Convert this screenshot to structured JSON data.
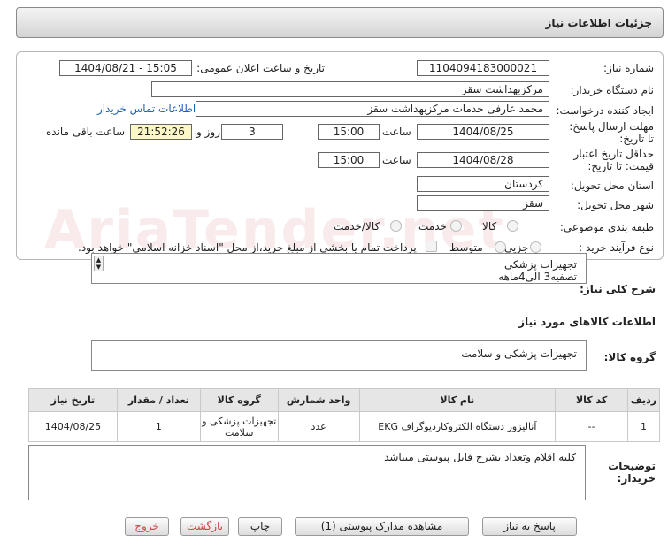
{
  "header": {
    "title": "جزئیات اطلاعات نیاز"
  },
  "watermark": "AriaTender.net",
  "form": {
    "need_number_label": "شماره نیاز:",
    "need_number": "1104094183000021",
    "announce_label": "تاریخ و ساعت اعلان عمومی:",
    "announce_value": "1404/08/21 - 15:05",
    "buyer_org_label": "نام دستگاه خریدار:",
    "buyer_org": "مرکزبهداشت سقز",
    "creator_label": "ایجاد کننده درخواست:",
    "creator": "محمد عارفی خدمات مرکزبهداشت سقز",
    "contact_link": "اطلاعات تماس خریدار",
    "reply_deadline_label": "مهلت ارسال پاسخ: تا تاریخ:",
    "reply_date": "1404/08/25",
    "time_label": "ساعت",
    "reply_time": "15:00",
    "days_value": "3",
    "days_and_label": "روز و",
    "remaining_time": "21:52:26",
    "remaining_label": "ساعت باقی مانده",
    "validity_label": "حداقل تاریخ اعتبار قیمت: تا تاریخ:",
    "validity_date": "1404/08/28",
    "validity_time": "15:00",
    "province_label": "استان محل تحویل:",
    "province": "کردستان",
    "city_label": "شهر محل تحویل:",
    "city": "سقز",
    "category_label": "طبقه بندی موضوعی:",
    "category_options": [
      "کالا",
      "خدمت",
      "کالا/خدمت"
    ],
    "process_label": "نوع فرآیند خرید :",
    "process_options": [
      "جزیی",
      "متوسط"
    ],
    "payment_note": "پرداخت تمام یا بخشی از مبلغ خرید،از محل \"اسناد خزانه اسلامی\" خواهد بود."
  },
  "summary": {
    "label": "شرح کلی نیاز:",
    "line1": "تجهیزات پزشکی",
    "line2": "تصفیه3 الی4ماهه"
  },
  "goods": {
    "section_title": "اطلاعات کالاهای مورد نیاز",
    "group_label": "گروه کالا:",
    "group_value": "تجهیزات پزشکی و سلامت",
    "columns": [
      "ردیف",
      "کد کالا",
      "نام کالا",
      "واحد شمارش",
      "گروه کالا",
      "تعداد / مقدار",
      "تاریخ نیاز"
    ],
    "rows": [
      [
        "1",
        "--",
        "آنالیزور دستگاه الکتروکاردیوگراف EKG",
        "عدد",
        "تجهیزات پزشکی و سلامت",
        "1",
        "1404/08/25"
      ]
    ]
  },
  "buyer_notes": {
    "label": "توضیحات خریدار:",
    "text": "کلیه اقلام وتعداد بشرح فایل پیوستی میباشد"
  },
  "buttons": {
    "reply": "پاسخ به نیاز",
    "attachments": "مشاهده مدارک پیوستی (1)",
    "print": "چاپ",
    "back": "بازگشت",
    "exit": "خروج"
  }
}
